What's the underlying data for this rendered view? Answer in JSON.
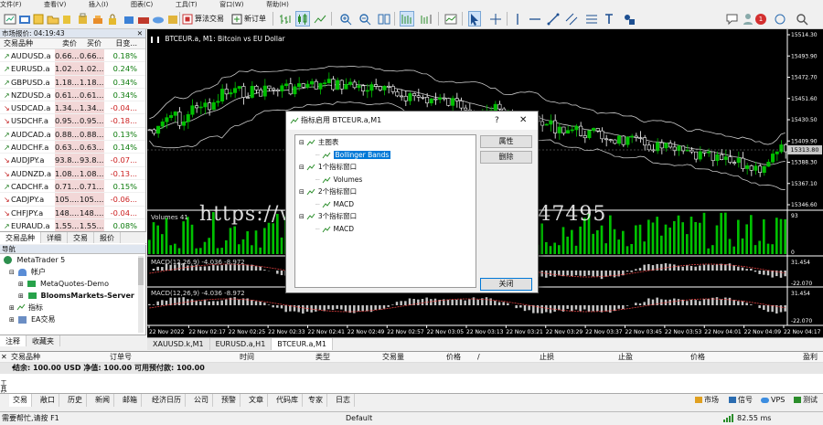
{
  "menu": [
    "文件(F)",
    "查看(V)",
    "插入(I)",
    "图表(C)",
    "工具(T)",
    "窗口(W)",
    "帮助(H)"
  ],
  "toolbar": {
    "algo_trading": "算法交易",
    "new_order": "新订单",
    "notification_count": "1"
  },
  "market_watch": {
    "title": "市场报价: 04:19:43",
    "columns": [
      "交易品种",
      "卖价",
      "买价",
      "日变..."
    ],
    "rows": [
      {
        "symbol": "AUDUSD.a",
        "bid": "0.66...",
        "ask": "0.66...",
        "change": "0.18%",
        "dir": "up"
      },
      {
        "symbol": "EURUSD.a",
        "bid": "1.02...",
        "ask": "1.02...",
        "change": "0.24%",
        "dir": "up"
      },
      {
        "symbol": "GBPUSD.a",
        "bid": "1.18...",
        "ask": "1.18...",
        "change": "0.34%",
        "dir": "up"
      },
      {
        "symbol": "NZDUSD.a",
        "bid": "0.61...",
        "ask": "0.61...",
        "change": "0.34%",
        "dir": "up"
      },
      {
        "symbol": "USDCAD.a",
        "bid": "1.34...",
        "ask": "1.34...",
        "change": "-0.04...",
        "dir": "dn"
      },
      {
        "symbol": "USDCHF.a",
        "bid": "0.95...",
        "ask": "0.95...",
        "change": "-0.18...",
        "dir": "dn"
      },
      {
        "symbol": "AUDCAD.a",
        "bid": "0.88...",
        "ask": "0.88...",
        "change": "0.13%",
        "dir": "up"
      },
      {
        "symbol": "AUDCHF.a",
        "bid": "0.63...",
        "ask": "0.63...",
        "change": "0.14%",
        "dir": "up"
      },
      {
        "symbol": "AUDJPY.a",
        "bid": "93.8...",
        "ask": "93.8...",
        "change": "-0.07...",
        "dir": "dn"
      },
      {
        "symbol": "AUDNZD.a",
        "bid": "1.08...",
        "ask": "1.08...",
        "change": "-0.13...",
        "dir": "dn"
      },
      {
        "symbol": "CADCHF.a",
        "bid": "0.71...",
        "ask": "0.71...",
        "change": "0.15%",
        "dir": "up"
      },
      {
        "symbol": "CADJPY.a",
        "bid": "105....",
        "ask": "105....",
        "change": "-0.06...",
        "dir": "dn"
      },
      {
        "symbol": "CHFJPY.a",
        "bid": "148....",
        "ask": "148....",
        "change": "-0.04...",
        "dir": "dn"
      },
      {
        "symbol": "EURAUD.a",
        "bid": "1.55...",
        "ask": "1.55...",
        "change": "0.08%",
        "dir": "up"
      }
    ],
    "tabs": [
      "交易品种",
      "详细",
      "交易",
      "报价"
    ]
  },
  "navigator": {
    "title": "导航",
    "items": [
      "MetaTrader 5",
      "帐户",
      "MetaQuotes-Demo",
      "BloomsMarkets-Server",
      "指标",
      "EA交易"
    ],
    "tabs": [
      "注释",
      "收藏夹"
    ]
  },
  "chart": {
    "title": "BTCEUR.a, M1:  Bitcoin vs EU Dollar",
    "volumes_label": "Volumes 41",
    "macd1_label": "MACD(12,26,9) -4.036 -8.972",
    "macd2_label": "MACD(12,26,9) -4.036 -8.972",
    "current_price": "15313.80",
    "price_ticks": [
      "15514.30",
      "15493.90",
      "15472.70",
      "15451.60",
      "15430.50",
      "15409.90",
      "15388.30",
      "15367.10",
      "15346.60"
    ],
    "time_ticks": [
      "22 Nov 2022",
      "22 Nov 02:17",
      "22 Nov 02:25",
      "22 Nov 02:33",
      "22 Nov 02:41",
      "22 Nov 02:49",
      "22 Nov 02:57",
      "22 Nov 03:05",
      "22 Nov 03:13",
      "22 Nov 03:21",
      "22 Nov 03:29",
      "22 Nov 03:37",
      "22 Nov 03:45",
      "22 Nov 03:53",
      "22 Nov 04:01",
      "22 Nov 04:09",
      "22 Nov 04:17"
    ],
    "vol_scale": [
      "93",
      "0"
    ],
    "macd_scale_top": "31.454",
    "macd_scale_bot": "-22.070",
    "macd2_scale_top": "31.454",
    "macd2_scale_bot": "-22.070",
    "colors": {
      "bull": "#00c000",
      "bear": "#ffffff",
      "bands": "#c8c8c8",
      "volume": "#00c000"
    }
  },
  "chart_tabs": [
    "XAUUSD.k,M1",
    "EURUSD.a,H1",
    "BTCEUR.a,M1"
  ],
  "terminal": {
    "columns": [
      "交易品种",
      "订单号",
      "时间",
      "类型",
      "交易量",
      "价格",
      "/",
      "止损",
      "止盈",
      "价格",
      "盈利"
    ],
    "balance_row": "结余: 100.00 USD  净值: 100.00  可用预付款: 100.00",
    "side_label": "工具箱",
    "tabs": [
      "交易",
      "敞口",
      "历史",
      "新闻",
      "邮箱",
      "经济日历",
      "公司",
      "预警",
      "文章",
      "代码库",
      "专家",
      "日志"
    ],
    "right_tabs": [
      "市场",
      "信号",
      "VPS",
      "测试"
    ]
  },
  "status": {
    "help": "需要帮忙,请按 F1",
    "profile": "Default",
    "ping": "82.55 ms"
  },
  "dialog": {
    "title": "指标启用 BTCEUR.a,M1",
    "help": "?",
    "close": "✕",
    "tree": [
      {
        "text": "主图表",
        "level": 0
      },
      {
        "text": "Bollinger Bands",
        "level": 1,
        "selected": true
      },
      {
        "text": "1个指标窗口",
        "level": 0
      },
      {
        "text": "Volumes",
        "level": 1
      },
      {
        "text": "2个指标窗口",
        "level": 0
      },
      {
        "text": "MACD",
        "level": 1
      },
      {
        "text": "3个指标窗口",
        "level": 0
      },
      {
        "text": "MACD",
        "level": 1
      }
    ],
    "buttons": {
      "properties": "属性",
      "delete": "删除",
      "close": "关闭"
    }
  },
  "watermark": "https://www.huzhan.com/ishop47495"
}
